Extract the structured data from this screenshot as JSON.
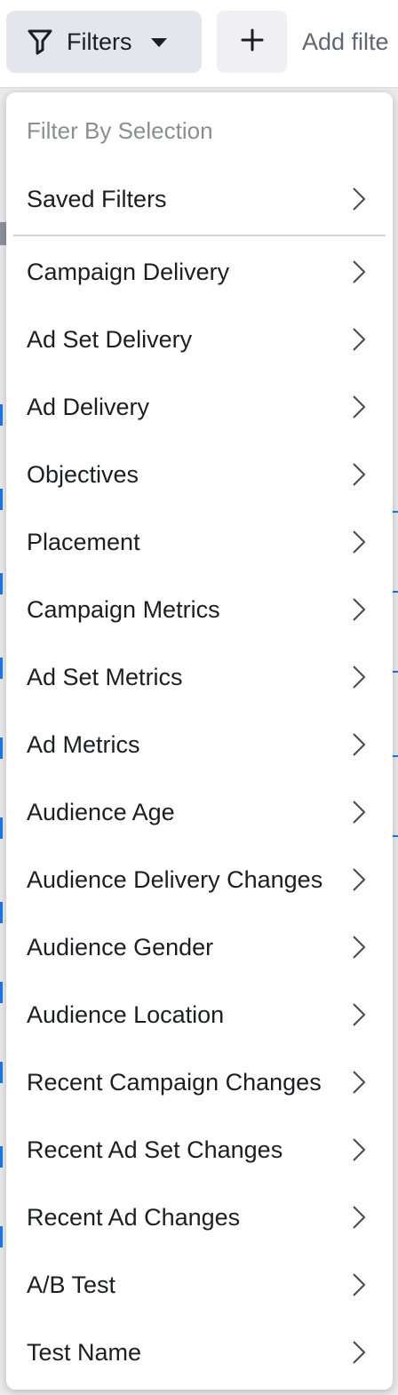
{
  "toolbar": {
    "filters_label": "Filters",
    "add_filter_placeholder": "Add filte",
    "icons": {
      "filters_icon": "funnel-icon",
      "filters_caret": "caret-down-icon",
      "add": "plus-icon"
    }
  },
  "menu": {
    "header": "Filter By Selection",
    "saved_filters": {
      "label": "Saved Filters",
      "icon": "chevron-right-icon"
    },
    "items": [
      {
        "label": "Campaign Delivery",
        "icon": "chevron-right-icon"
      },
      {
        "label": "Ad Set Delivery",
        "icon": "chevron-right-icon"
      },
      {
        "label": "Ad Delivery",
        "icon": "chevron-right-icon"
      },
      {
        "label": "Objectives",
        "icon": "chevron-right-icon"
      },
      {
        "label": "Placement",
        "icon": "chevron-right-icon"
      },
      {
        "label": "Campaign Metrics",
        "icon": "chevron-right-icon"
      },
      {
        "label": "Ad Set Metrics",
        "icon": "chevron-right-icon"
      },
      {
        "label": "Ad Metrics",
        "icon": "chevron-right-icon"
      },
      {
        "label": "Audience Age",
        "icon": "chevron-right-icon"
      },
      {
        "label": "Audience Delivery Changes",
        "icon": "chevron-right-icon"
      },
      {
        "label": "Audience Gender",
        "icon": "chevron-right-icon"
      },
      {
        "label": "Audience Location",
        "icon": "chevron-right-icon"
      },
      {
        "label": "Recent Campaign Changes",
        "icon": "chevron-right-icon"
      },
      {
        "label": "Recent Ad Set Changes",
        "icon": "chevron-right-icon"
      },
      {
        "label": "Recent Ad Changes",
        "icon": "chevron-right-icon"
      },
      {
        "label": "A/B Test",
        "icon": "chevron-right-icon"
      },
      {
        "label": "Test Name",
        "icon": "chevron-right-icon"
      }
    ]
  },
  "colors": {
    "text": "#1c1e21",
    "muted": "#8a8d91",
    "button_bg": "#e4e6eb",
    "accent": "#1877f2"
  }
}
